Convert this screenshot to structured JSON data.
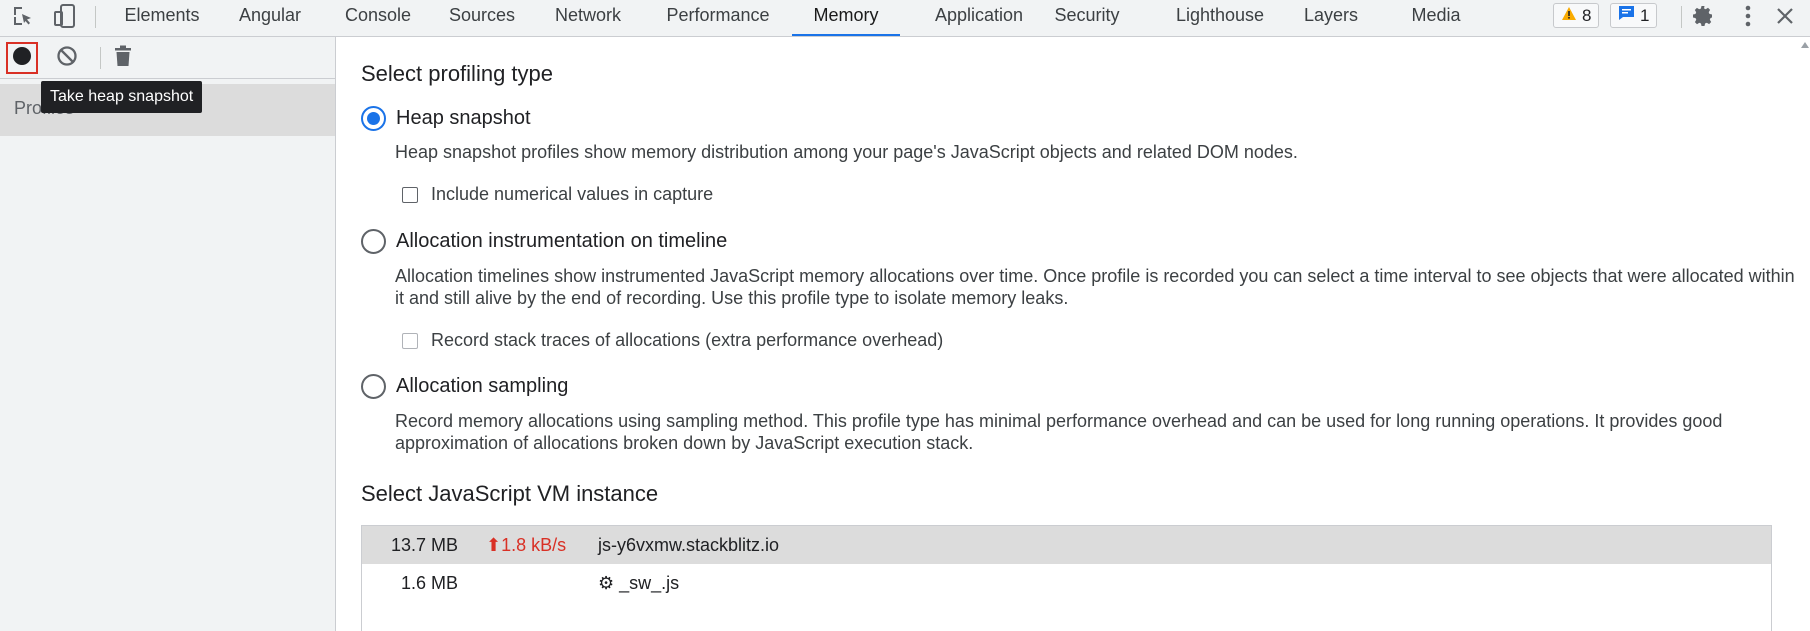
{
  "tabs": [
    {
      "label": "Elements",
      "active": false
    },
    {
      "label": "Angular",
      "active": false
    },
    {
      "label": "Console",
      "active": false
    },
    {
      "label": "Sources",
      "active": false
    },
    {
      "label": "Network",
      "active": false
    },
    {
      "label": "Performance",
      "active": false
    },
    {
      "label": "Memory",
      "active": true
    },
    {
      "label": "Application",
      "active": false
    },
    {
      "label": "Security",
      "active": false
    },
    {
      "label": "Lighthouse",
      "active": false
    },
    {
      "label": "Layers",
      "active": false
    },
    {
      "label": "Media",
      "active": false
    }
  ],
  "toolbar_right": {
    "warnings_count": "8",
    "messages_count": "1"
  },
  "sidebar": {
    "profiles_label": "Profiles",
    "tooltip": "Take heap snapshot"
  },
  "main": {
    "profiling_heading": "Select profiling type",
    "options": [
      {
        "label": "Heap snapshot",
        "selected": true,
        "description": "Heap snapshot profiles show memory distribution among your page's JavaScript objects and related DOM nodes.",
        "checkbox": {
          "label": "Include numerical values in capture",
          "checked": false,
          "disabled": false
        }
      },
      {
        "label": "Allocation instrumentation on timeline",
        "selected": false,
        "description": "Allocation timelines show instrumented JavaScript memory allocations over time. Once profile is recorded you can select a time interval to see objects that were allocated within it and still alive by the end of recording. Use this profile type to isolate memory leaks.",
        "checkbox": {
          "label": "Record stack traces of allocations (extra performance overhead)",
          "checked": false,
          "disabled": true
        }
      },
      {
        "label": "Allocation sampling",
        "selected": false,
        "description": "Record memory allocations using sampling method. This profile type has minimal performance overhead and can be used for long running operations. It provides good approximation of allocations broken down by JavaScript execution stack."
      }
    ],
    "vm_heading": "Select JavaScript VM instance",
    "vm_instances": [
      {
        "size": "13.7 MB",
        "speed": "⬆1.8 kB/s",
        "url": "js-y6vxmw.stackblitz.io",
        "selected": true
      },
      {
        "size": "1.6 MB",
        "speed": "",
        "url": "⚙ _sw_.js",
        "selected": false
      }
    ]
  },
  "colors": {
    "accent": "#1a73e8",
    "record_outline": "#d93025",
    "speed_text": "#d93025"
  }
}
